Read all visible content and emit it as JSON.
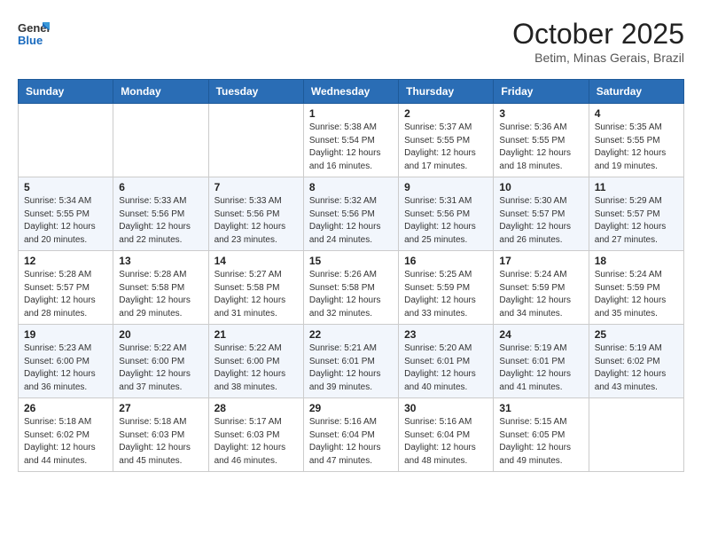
{
  "header": {
    "logo_general": "General",
    "logo_blue": "Blue",
    "month_title": "October 2025",
    "location": "Betim, Minas Gerais, Brazil"
  },
  "weekdays": [
    "Sunday",
    "Monday",
    "Tuesday",
    "Wednesday",
    "Thursday",
    "Friday",
    "Saturday"
  ],
  "weeks": [
    [
      {
        "day": "",
        "sunrise": "",
        "sunset": "",
        "daylight": ""
      },
      {
        "day": "",
        "sunrise": "",
        "sunset": "",
        "daylight": ""
      },
      {
        "day": "",
        "sunrise": "",
        "sunset": "",
        "daylight": ""
      },
      {
        "day": "1",
        "sunrise": "Sunrise: 5:38 AM",
        "sunset": "Sunset: 5:54 PM",
        "daylight": "Daylight: 12 hours and 16 minutes."
      },
      {
        "day": "2",
        "sunrise": "Sunrise: 5:37 AM",
        "sunset": "Sunset: 5:55 PM",
        "daylight": "Daylight: 12 hours and 17 minutes."
      },
      {
        "day": "3",
        "sunrise": "Sunrise: 5:36 AM",
        "sunset": "Sunset: 5:55 PM",
        "daylight": "Daylight: 12 hours and 18 minutes."
      },
      {
        "day": "4",
        "sunrise": "Sunrise: 5:35 AM",
        "sunset": "Sunset: 5:55 PM",
        "daylight": "Daylight: 12 hours and 19 minutes."
      }
    ],
    [
      {
        "day": "5",
        "sunrise": "Sunrise: 5:34 AM",
        "sunset": "Sunset: 5:55 PM",
        "daylight": "Daylight: 12 hours and 20 minutes."
      },
      {
        "day": "6",
        "sunrise": "Sunrise: 5:33 AM",
        "sunset": "Sunset: 5:56 PM",
        "daylight": "Daylight: 12 hours and 22 minutes."
      },
      {
        "day": "7",
        "sunrise": "Sunrise: 5:33 AM",
        "sunset": "Sunset: 5:56 PM",
        "daylight": "Daylight: 12 hours and 23 minutes."
      },
      {
        "day": "8",
        "sunrise": "Sunrise: 5:32 AM",
        "sunset": "Sunset: 5:56 PM",
        "daylight": "Daylight: 12 hours and 24 minutes."
      },
      {
        "day": "9",
        "sunrise": "Sunrise: 5:31 AM",
        "sunset": "Sunset: 5:56 PM",
        "daylight": "Daylight: 12 hours and 25 minutes."
      },
      {
        "day": "10",
        "sunrise": "Sunrise: 5:30 AM",
        "sunset": "Sunset: 5:57 PM",
        "daylight": "Daylight: 12 hours and 26 minutes."
      },
      {
        "day": "11",
        "sunrise": "Sunrise: 5:29 AM",
        "sunset": "Sunset: 5:57 PM",
        "daylight": "Daylight: 12 hours and 27 minutes."
      }
    ],
    [
      {
        "day": "12",
        "sunrise": "Sunrise: 5:28 AM",
        "sunset": "Sunset: 5:57 PM",
        "daylight": "Daylight: 12 hours and 28 minutes."
      },
      {
        "day": "13",
        "sunrise": "Sunrise: 5:28 AM",
        "sunset": "Sunset: 5:58 PM",
        "daylight": "Daylight: 12 hours and 29 minutes."
      },
      {
        "day": "14",
        "sunrise": "Sunrise: 5:27 AM",
        "sunset": "Sunset: 5:58 PM",
        "daylight": "Daylight: 12 hours and 31 minutes."
      },
      {
        "day": "15",
        "sunrise": "Sunrise: 5:26 AM",
        "sunset": "Sunset: 5:58 PM",
        "daylight": "Daylight: 12 hours and 32 minutes."
      },
      {
        "day": "16",
        "sunrise": "Sunrise: 5:25 AM",
        "sunset": "Sunset: 5:59 PM",
        "daylight": "Daylight: 12 hours and 33 minutes."
      },
      {
        "day": "17",
        "sunrise": "Sunrise: 5:24 AM",
        "sunset": "Sunset: 5:59 PM",
        "daylight": "Daylight: 12 hours and 34 minutes."
      },
      {
        "day": "18",
        "sunrise": "Sunrise: 5:24 AM",
        "sunset": "Sunset: 5:59 PM",
        "daylight": "Daylight: 12 hours and 35 minutes."
      }
    ],
    [
      {
        "day": "19",
        "sunrise": "Sunrise: 5:23 AM",
        "sunset": "Sunset: 6:00 PM",
        "daylight": "Daylight: 12 hours and 36 minutes."
      },
      {
        "day": "20",
        "sunrise": "Sunrise: 5:22 AM",
        "sunset": "Sunset: 6:00 PM",
        "daylight": "Daylight: 12 hours and 37 minutes."
      },
      {
        "day": "21",
        "sunrise": "Sunrise: 5:22 AM",
        "sunset": "Sunset: 6:00 PM",
        "daylight": "Daylight: 12 hours and 38 minutes."
      },
      {
        "day": "22",
        "sunrise": "Sunrise: 5:21 AM",
        "sunset": "Sunset: 6:01 PM",
        "daylight": "Daylight: 12 hours and 39 minutes."
      },
      {
        "day": "23",
        "sunrise": "Sunrise: 5:20 AM",
        "sunset": "Sunset: 6:01 PM",
        "daylight": "Daylight: 12 hours and 40 minutes."
      },
      {
        "day": "24",
        "sunrise": "Sunrise: 5:19 AM",
        "sunset": "Sunset: 6:01 PM",
        "daylight": "Daylight: 12 hours and 41 minutes."
      },
      {
        "day": "25",
        "sunrise": "Sunrise: 5:19 AM",
        "sunset": "Sunset: 6:02 PM",
        "daylight": "Daylight: 12 hours and 43 minutes."
      }
    ],
    [
      {
        "day": "26",
        "sunrise": "Sunrise: 5:18 AM",
        "sunset": "Sunset: 6:02 PM",
        "daylight": "Daylight: 12 hours and 44 minutes."
      },
      {
        "day": "27",
        "sunrise": "Sunrise: 5:18 AM",
        "sunset": "Sunset: 6:03 PM",
        "daylight": "Daylight: 12 hours and 45 minutes."
      },
      {
        "day": "28",
        "sunrise": "Sunrise: 5:17 AM",
        "sunset": "Sunset: 6:03 PM",
        "daylight": "Daylight: 12 hours and 46 minutes."
      },
      {
        "day": "29",
        "sunrise": "Sunrise: 5:16 AM",
        "sunset": "Sunset: 6:04 PM",
        "daylight": "Daylight: 12 hours and 47 minutes."
      },
      {
        "day": "30",
        "sunrise": "Sunrise: 5:16 AM",
        "sunset": "Sunset: 6:04 PM",
        "daylight": "Daylight: 12 hours and 48 minutes."
      },
      {
        "day": "31",
        "sunrise": "Sunrise: 5:15 AM",
        "sunset": "Sunset: 6:05 PM",
        "daylight": "Daylight: 12 hours and 49 minutes."
      },
      {
        "day": "",
        "sunrise": "",
        "sunset": "",
        "daylight": ""
      }
    ]
  ]
}
